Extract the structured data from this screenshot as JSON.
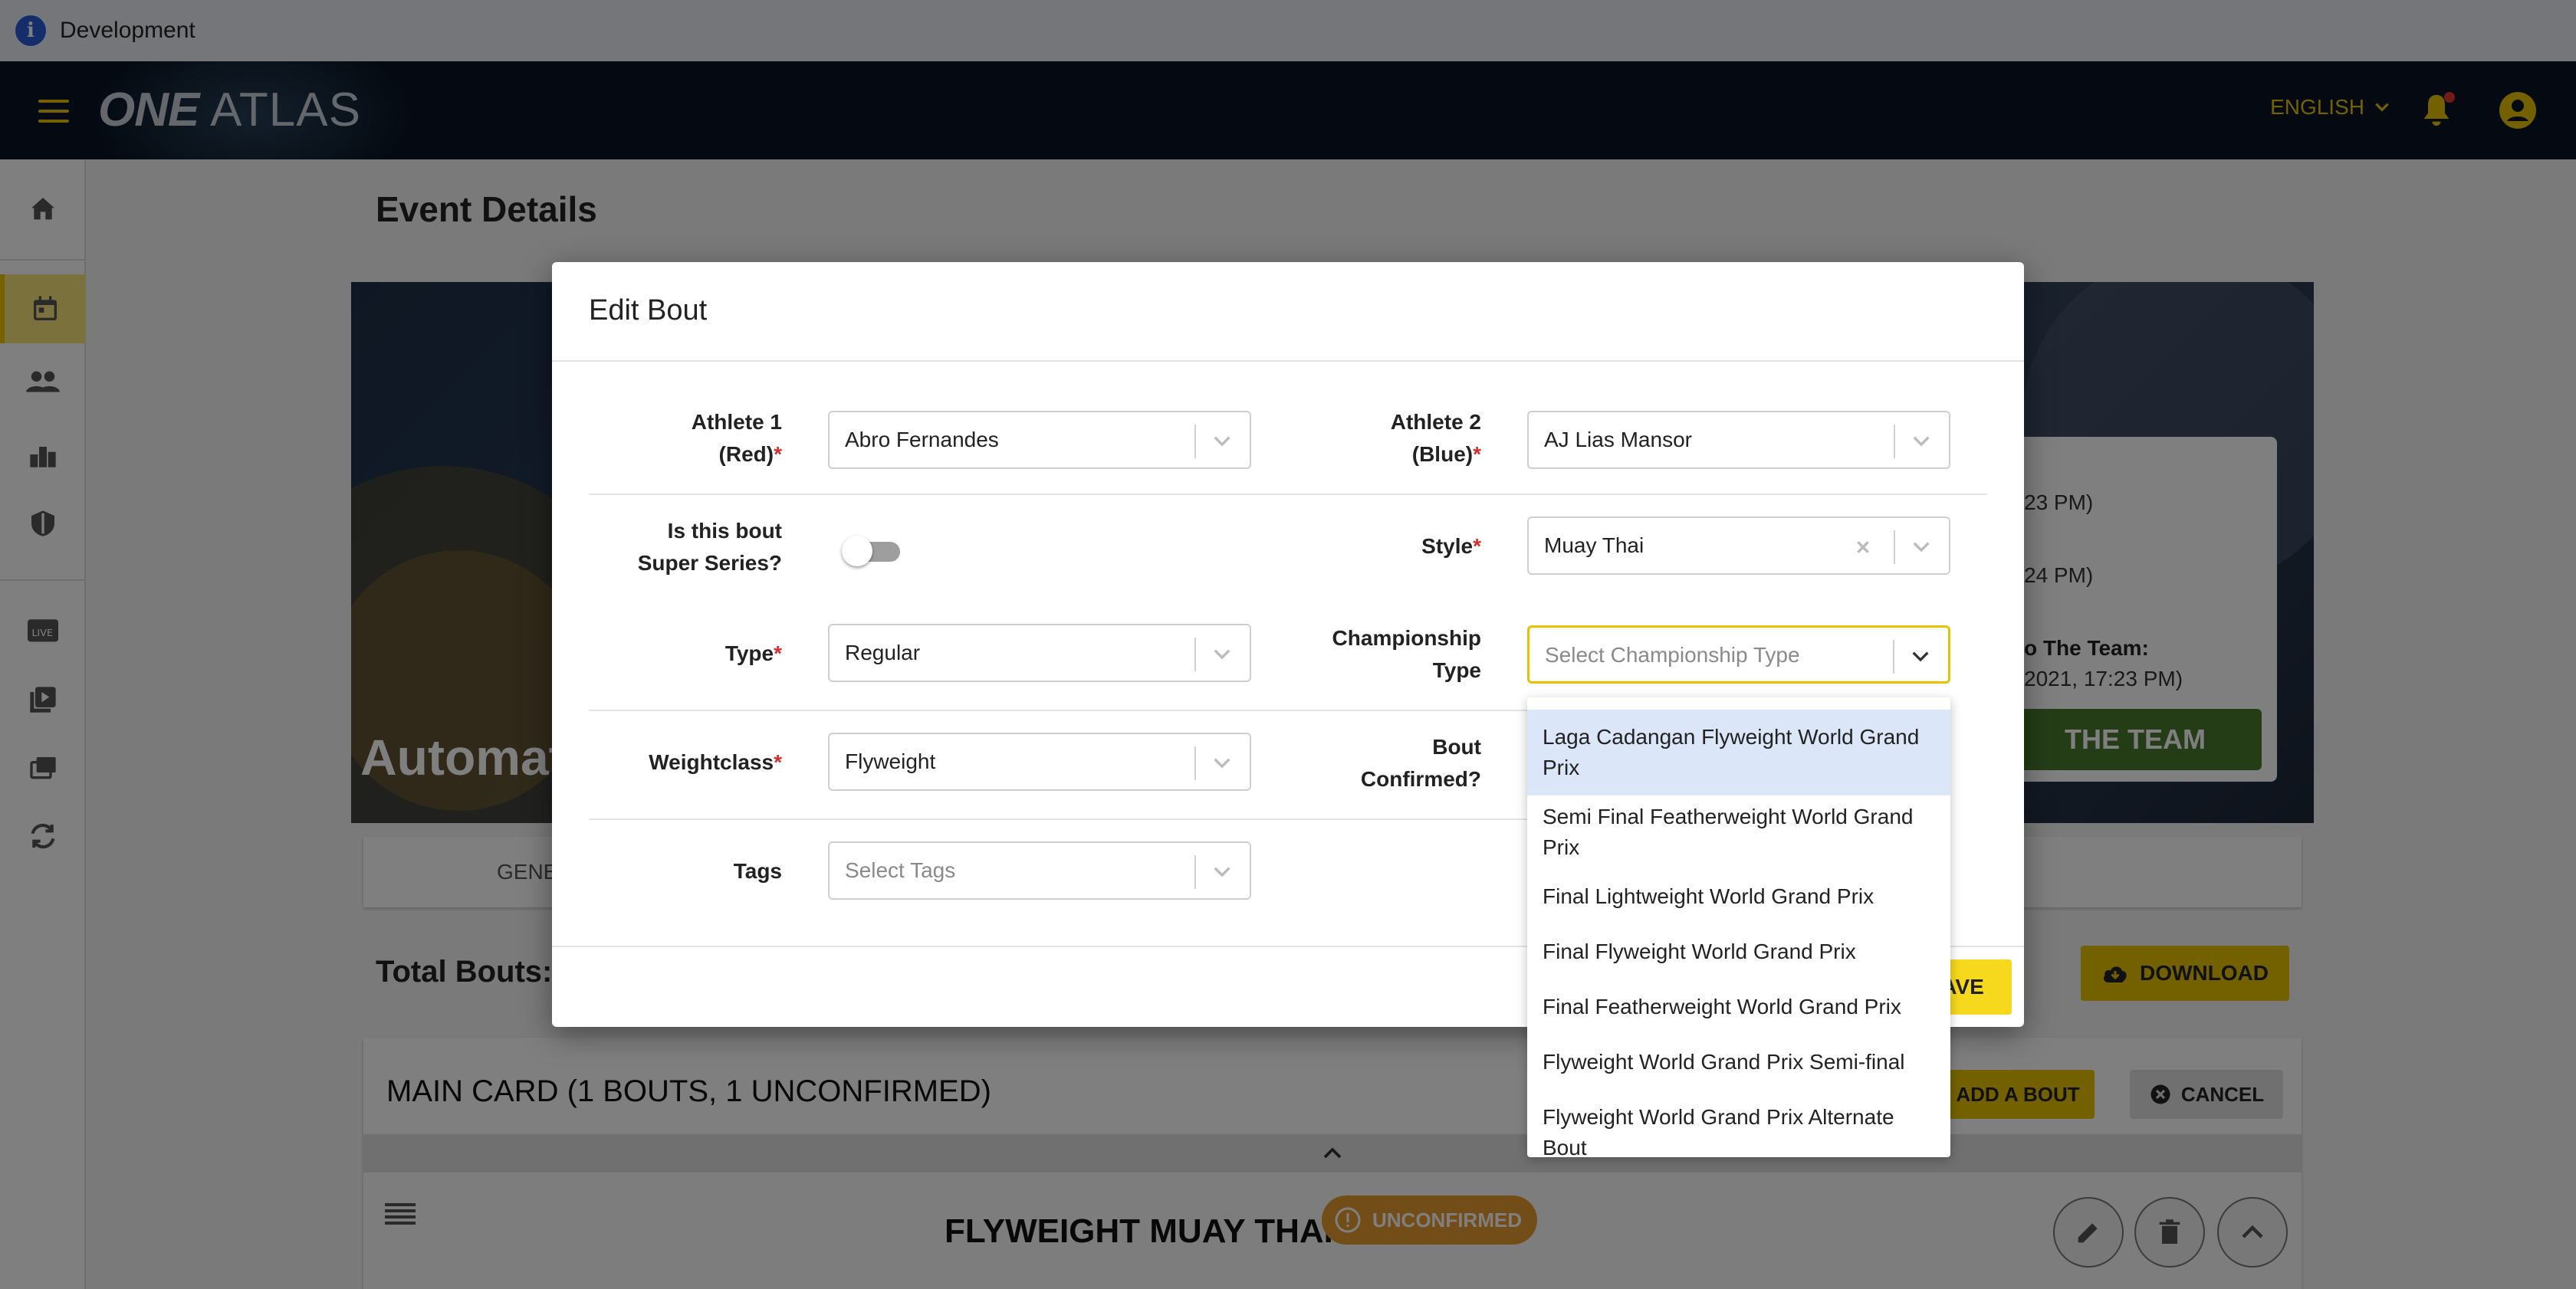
{
  "dev_banner": {
    "text": "Development"
  },
  "header": {
    "logo_bold": "ONE",
    "logo_rest": "ATLAS",
    "language": "ENGLISH"
  },
  "page": {
    "title": "Event Details",
    "hero_text": "Automat",
    "hero_card": {
      "line1": "23 PM)",
      "line2": "24 PM)",
      "line3": "o The Team:",
      "line4": "2021, 17:23 PM)",
      "button": "THE TEAM"
    },
    "tab_partial": "GENE",
    "total_bouts": "Total Bouts:",
    "download": "DOWNLOAD",
    "main_card": {
      "title": "MAIN CARD (1 BOUTS, 1 UNCONFIRMED)",
      "add_bout": "ADD A BOUT",
      "cancel": "CANCEL",
      "bout_title": "FLYWEIGHT  MUAY THAI",
      "status": "UNCONFIRMED"
    }
  },
  "modal": {
    "title": "Edit Bout",
    "athlete1": {
      "label1": "Athlete 1",
      "label2": "(Red)",
      "value": "Abro Fernandes"
    },
    "athlete2": {
      "label1": "Athlete 2",
      "label2": "(Blue)",
      "value": "AJ Lias Mansor"
    },
    "super_series": {
      "label1": "Is this bout",
      "label2": "Super Series?"
    },
    "style": {
      "label": "Style",
      "value": "Muay Thai"
    },
    "type": {
      "label": "Type",
      "value": "Regular"
    },
    "championship": {
      "label1": "Championship",
      "label2": "Type",
      "placeholder": "Select Championship Type"
    },
    "weightclass": {
      "label": "Weightclass",
      "value": "Flyweight"
    },
    "bout_confirmed": {
      "label1": "Bout",
      "label2": "Confirmed?"
    },
    "tags": {
      "label": "Tags",
      "placeholder": "Select Tags"
    },
    "save_partial": "AVE",
    "required_mark": "*"
  },
  "dropdown": {
    "options": [
      "Laga Cadangan Flyweight World Grand Prix",
      "Semi Final Featherweight World Grand Prix",
      "Final Lightweight World Grand Prix",
      "Final Flyweight World Grand Prix",
      "Final Featherweight World Grand Prix",
      "Flyweight World Grand Prix Semi-final",
      "Flyweight World Grand Prix Alternate Bout"
    ]
  },
  "colors": {
    "accent": "#e6c200",
    "header_bg": "#0a1524",
    "highlight": "#dbe6f8",
    "required": "#d32f2f",
    "warning": "#e69a2e"
  }
}
